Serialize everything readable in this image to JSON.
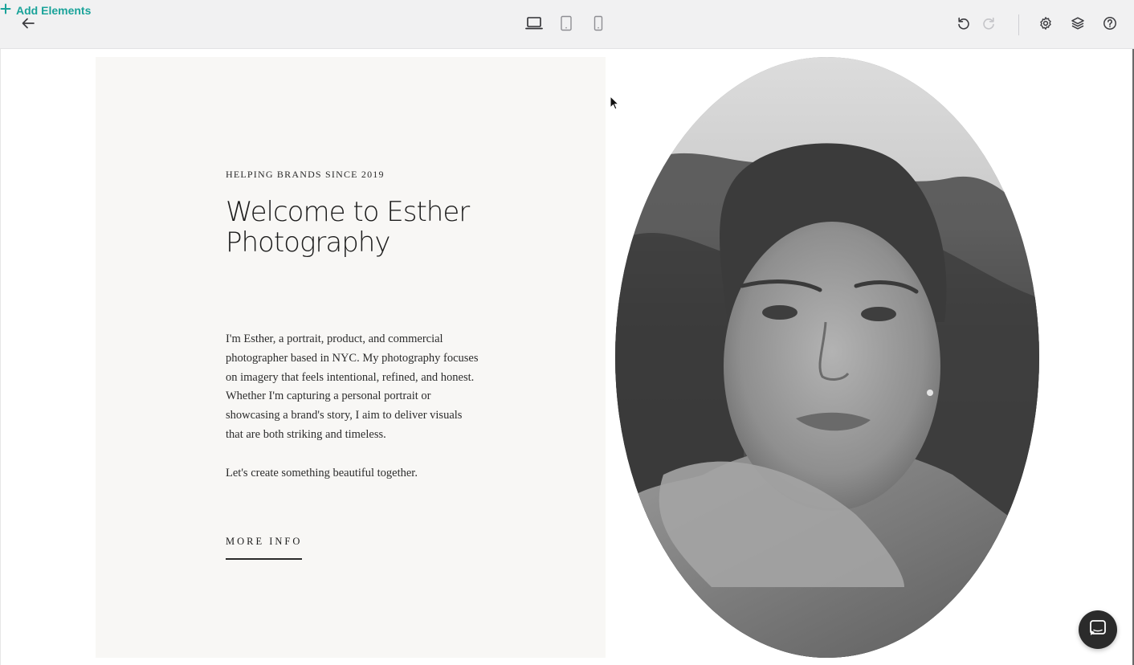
{
  "toolbar": {
    "back_icon": "arrow-left-icon",
    "add_elements_label": "Add Elements",
    "device_modes": [
      "desktop",
      "tablet",
      "mobile"
    ],
    "selected_device": "desktop",
    "accent_color": "#1aa39a"
  },
  "hero": {
    "eyebrow": "HELPING BRANDS SINCE 2019",
    "headline": "Welcome to Esther Photography",
    "body": "I'm Esther, a portrait, product, and commercial photographer based in NYC. My photography focuses on imagery that feels intentional, refined, and honest. Whether I'm capturing a personal portrait or showcasing a brand's story, I aim to deliver visuals that are both striking and timeless.",
    "closing": "Let's create something beautiful together.",
    "cta_label": "MORE INFO"
  },
  "chat": {
    "icon": "chat-icon"
  }
}
